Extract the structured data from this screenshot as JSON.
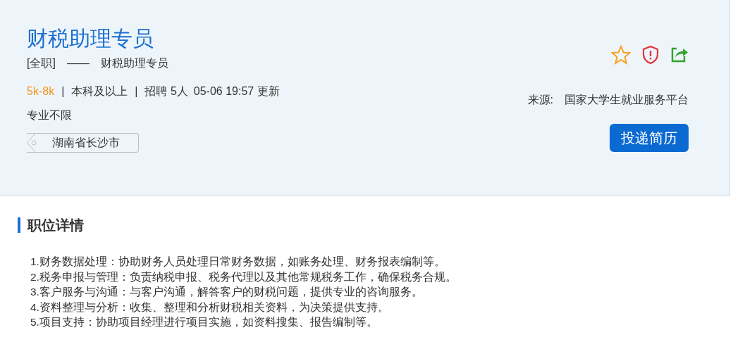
{
  "job": {
    "title": "财税助理专员",
    "job_type": "[全职]",
    "dash": "——",
    "role": "财税助理专员",
    "salary": "5k-8k",
    "separator": "|",
    "education": "本科及以上",
    "headcount": "招聘 5人",
    "updated": "05-06 19:57 更新",
    "major": "专业不限",
    "location": "湖南省长沙市",
    "source_label": "来源:",
    "source": "国家大学生就业服务平台",
    "apply_button": "投递简历"
  },
  "details": {
    "title": "职位详情",
    "items": [
      "1.财务数据处理：协助财务人员处理日常财务数据，如账务处理、财务报表编制等。",
      "2.税务申报与管理：负责纳税申报、税务代理以及其他常规税务工作，确保税务合规。",
      "3.客户服务与沟通：与客户沟通，解答客户的财税问题，提供专业的咨询服务。",
      "4.资料整理与分析：收集、整理和分析财税相关资料，为决策提供支持。",
      "5.项目支持：协助项目经理进行项目实施，如资料搜集、报告编制等。"
    ]
  }
}
